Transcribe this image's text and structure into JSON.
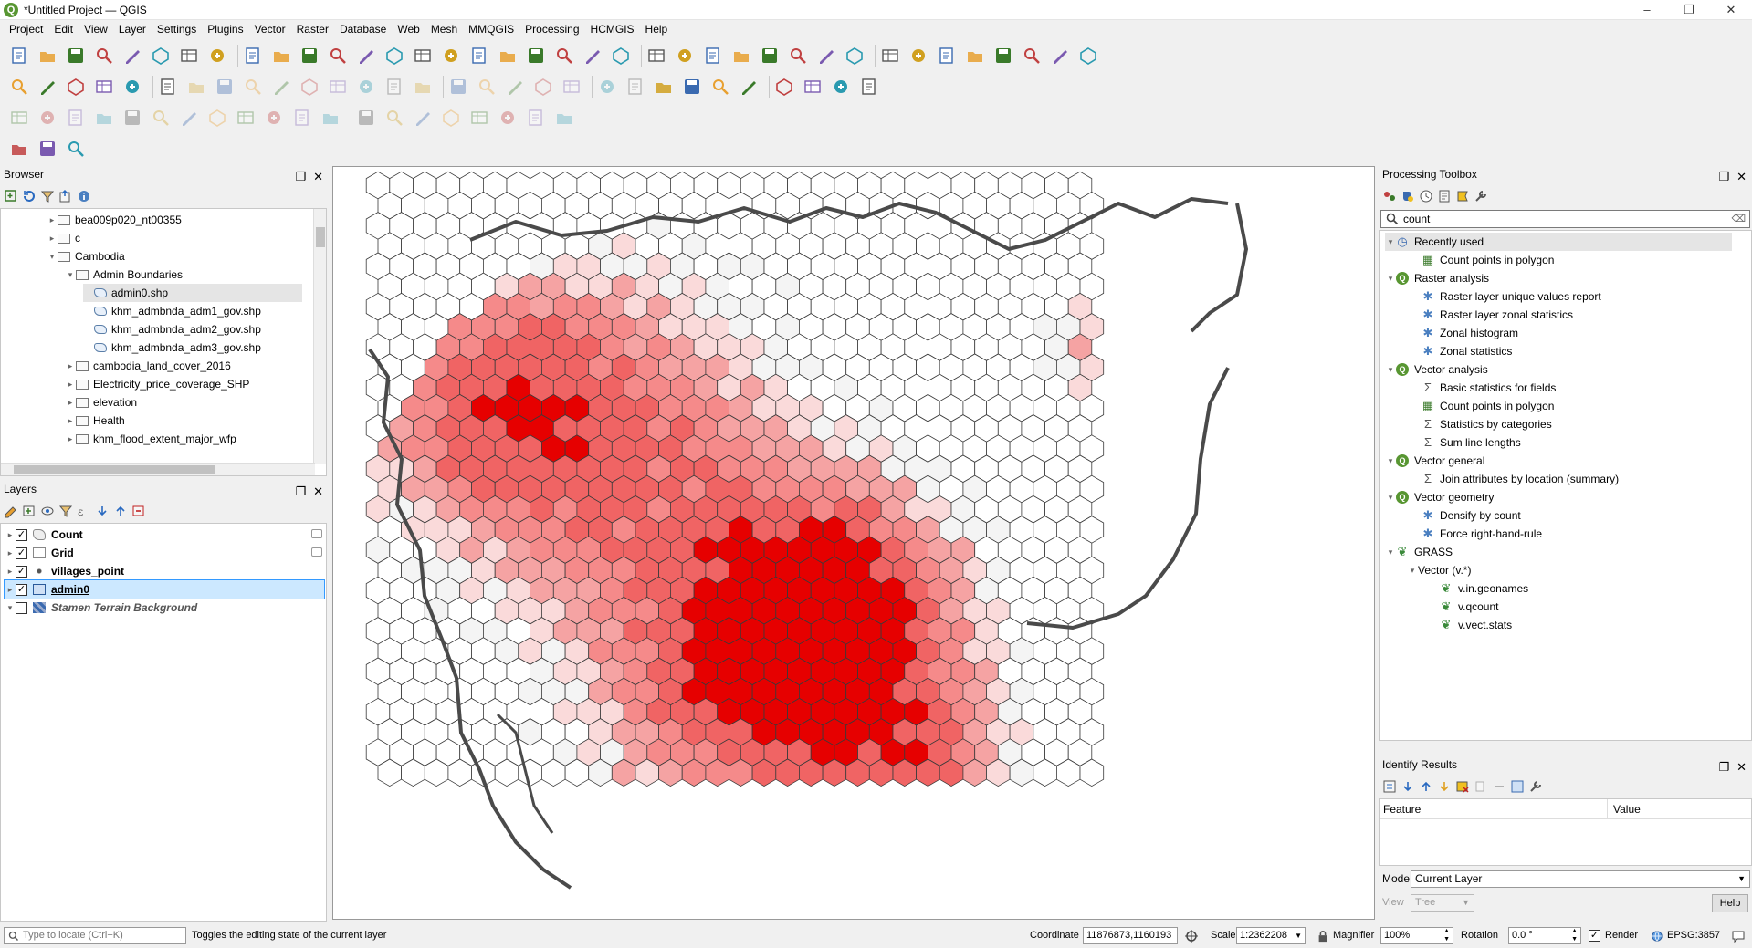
{
  "window": {
    "title": "*Untitled Project — QGIS",
    "minimize": "–",
    "maximize": "❐",
    "close": "✕"
  },
  "menu": [
    "Project",
    "Edit",
    "View",
    "Layer",
    "Settings",
    "Plugins",
    "Vector",
    "Raster",
    "Database",
    "Web",
    "Mesh",
    "MMQGIS",
    "Processing",
    "HCMGIS",
    "Help"
  ],
  "browser": {
    "title": "Browser",
    "items": [
      {
        "label": "bea009p020_nt00355",
        "level": 2,
        "type": "folder",
        "expander": "▸"
      },
      {
        "label": "c",
        "level": 2,
        "type": "folder",
        "expander": "▸"
      },
      {
        "label": "Cambodia",
        "level": 2,
        "type": "folder",
        "expander": "▾"
      },
      {
        "label": "Admin Boundaries",
        "level": 3,
        "type": "folder",
        "expander": "▾"
      },
      {
        "label": "admin0.shp",
        "level": 4,
        "type": "shp",
        "expander": "",
        "selected": true
      },
      {
        "label": "khm_admbnda_adm1_gov.shp",
        "level": 4,
        "type": "shp",
        "expander": ""
      },
      {
        "label": "khm_admbnda_adm2_gov.shp",
        "level": 4,
        "type": "shp",
        "expander": ""
      },
      {
        "label": "khm_admbnda_adm3_gov.shp",
        "level": 4,
        "type": "shp",
        "expander": ""
      },
      {
        "label": "cambodia_land_cover_2016",
        "level": 3,
        "type": "folder",
        "expander": "▸"
      },
      {
        "label": "Electricity_price_coverage_SHP",
        "level": 3,
        "type": "folder",
        "expander": "▸"
      },
      {
        "label": "elevation",
        "level": 3,
        "type": "folder",
        "expander": "▸"
      },
      {
        "label": "Health",
        "level": 3,
        "type": "folder",
        "expander": "▸"
      },
      {
        "label": "khm_flood_extent_major_wfp",
        "level": 3,
        "type": "folder",
        "expander": "▸"
      }
    ]
  },
  "layers": {
    "title": "Layers",
    "items": [
      {
        "label": "Count",
        "checked": true,
        "bold": true,
        "italic": false,
        "underline": false,
        "icon": "polygon"
      },
      {
        "label": "Grid",
        "checked": true,
        "bold": true,
        "italic": false,
        "underline": false,
        "icon": "polygon-empty"
      },
      {
        "label": "villages_point",
        "checked": true,
        "bold": true,
        "italic": false,
        "underline": false,
        "icon": "point"
      },
      {
        "label": "admin0",
        "checked": true,
        "bold": true,
        "italic": false,
        "underline": true,
        "icon": "polygon-blue",
        "selected": true
      },
      {
        "label": "Stamen Terrain Background",
        "checked": false,
        "bold": true,
        "italic": true,
        "underline": false,
        "icon": "raster"
      }
    ]
  },
  "toolbox": {
    "title": "Processing Toolbox",
    "search_value": "count",
    "items": [
      {
        "label": "Recently used",
        "level": 0,
        "icon": "clock",
        "expander": "▾",
        "selected": true
      },
      {
        "label": "Count points in polygon",
        "level": 1,
        "icon": "tool"
      },
      {
        "label": "Raster analysis",
        "level": 0,
        "icon": "qgis",
        "expander": "▾"
      },
      {
        "label": "Raster layer unique values report",
        "level": 1,
        "icon": "gear"
      },
      {
        "label": "Raster layer zonal statistics",
        "level": 1,
        "icon": "gear"
      },
      {
        "label": "Zonal histogram",
        "level": 1,
        "icon": "gear"
      },
      {
        "label": "Zonal statistics",
        "level": 1,
        "icon": "gear"
      },
      {
        "label": "Vector analysis",
        "level": 0,
        "icon": "qgis",
        "expander": "▾"
      },
      {
        "label": "Basic statistics for fields",
        "level": 1,
        "icon": "sigma"
      },
      {
        "label": "Count points in polygon",
        "level": 1,
        "icon": "tool"
      },
      {
        "label": "Statistics by categories",
        "level": 1,
        "icon": "sigma"
      },
      {
        "label": "Sum line lengths",
        "level": 1,
        "icon": "sigma"
      },
      {
        "label": "Vector general",
        "level": 0,
        "icon": "qgis",
        "expander": "▾"
      },
      {
        "label": "Join attributes by location (summary)",
        "level": 1,
        "icon": "sigma"
      },
      {
        "label": "Vector geometry",
        "level": 0,
        "icon": "qgis",
        "expander": "▾"
      },
      {
        "label": "Densify by count",
        "level": 1,
        "icon": "gear"
      },
      {
        "label": "Force right-hand-rule",
        "level": 1,
        "icon": "gear"
      },
      {
        "label": "GRASS",
        "level": 0,
        "icon": "grass",
        "expander": "▾"
      },
      {
        "label": "Vector (v.*)",
        "level": 1,
        "icon": "none",
        "expander": "▾"
      },
      {
        "label": "v.in.geonames",
        "level": 2,
        "icon": "grass"
      },
      {
        "label": "v.qcount",
        "level": 2,
        "icon": "grass"
      },
      {
        "label": "v.vect.stats",
        "level": 2,
        "icon": "grass"
      }
    ]
  },
  "identify": {
    "title": "Identify Results",
    "col_feature": "Feature",
    "col_value": "Value",
    "mode_label": "Mode",
    "mode_value": "Current Layer",
    "view_label": "View",
    "view_value": "Tree",
    "help_label": "Help"
  },
  "status": {
    "locate_placeholder": "Type to locate (Ctrl+K)",
    "message": "Toggles the editing state of the current layer",
    "coordinate_label": "Coordinate",
    "coordinate_value": "11876873,1160193",
    "scale_label": "Scale",
    "scale_value": "1:2362208",
    "magnifier_label": "Magnifier",
    "magnifier_value": "100%",
    "rotation_label": "Rotation",
    "rotation_value": "0.0 °",
    "render_label": "Render",
    "crs_label": "EPSG:3857"
  },
  "colors": {
    "accent": "#589632",
    "hex_light": "#fadada",
    "hex_mid": "#f5a3a3",
    "hex_strong": "#f06464",
    "hex_max": "#e60000",
    "border_line": "#4a4a4a",
    "selection": "#cce8ff"
  }
}
